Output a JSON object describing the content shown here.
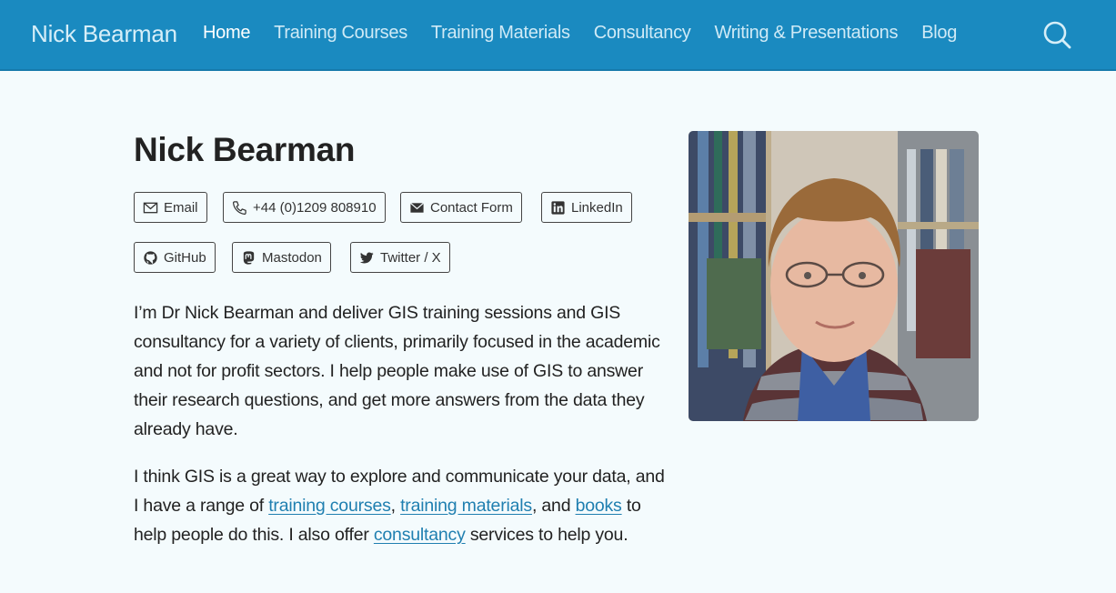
{
  "site": {
    "brand": "Nick Bearman"
  },
  "nav": {
    "items": [
      {
        "label": "Home",
        "active": true
      },
      {
        "label": "Training Courses"
      },
      {
        "label": "Training Materials"
      },
      {
        "label": "Consultancy"
      },
      {
        "label": "Writing & Presentations"
      },
      {
        "label": "Blog"
      }
    ],
    "search_icon": "search-icon"
  },
  "main": {
    "title": "Nick Bearman",
    "contact_buttons": [
      {
        "label": "Email",
        "icon": "envelope-icon"
      },
      {
        "label": "+44 (0)1209 808910",
        "icon": "phone-icon"
      },
      {
        "label": "Contact Form",
        "icon": "envelope-filled-icon"
      },
      {
        "label": "LinkedIn",
        "icon": "linkedin-icon"
      },
      {
        "label": "GitHub",
        "icon": "github-icon"
      },
      {
        "label": "Mastodon",
        "icon": "mastodon-icon"
      },
      {
        "label": "Twitter / X",
        "icon": "twitter-icon"
      }
    ],
    "para1": "I’m Dr Nick Bearman and deliver GIS training sessions and GIS consultancy for a variety of clients, primarily focused in the academic and not for profit sectors. I help people make use of GIS to answer their research questions, and get more answers from the data they already have.",
    "para2": {
      "t1": "I think GIS is a great way to explore and communicate your data, and I have a range of ",
      "link1": "training courses",
      "t2": ", ",
      "link2": "training materials",
      "t3": ", and ",
      "link3": "books",
      "t4": " to help people do this. I also offer ",
      "link4": "consultancy",
      "t5": " services to help you."
    }
  },
  "colors": {
    "navbar": "#1a8ac0",
    "background": "#f4fbfd",
    "link": "#1f7fb0"
  }
}
